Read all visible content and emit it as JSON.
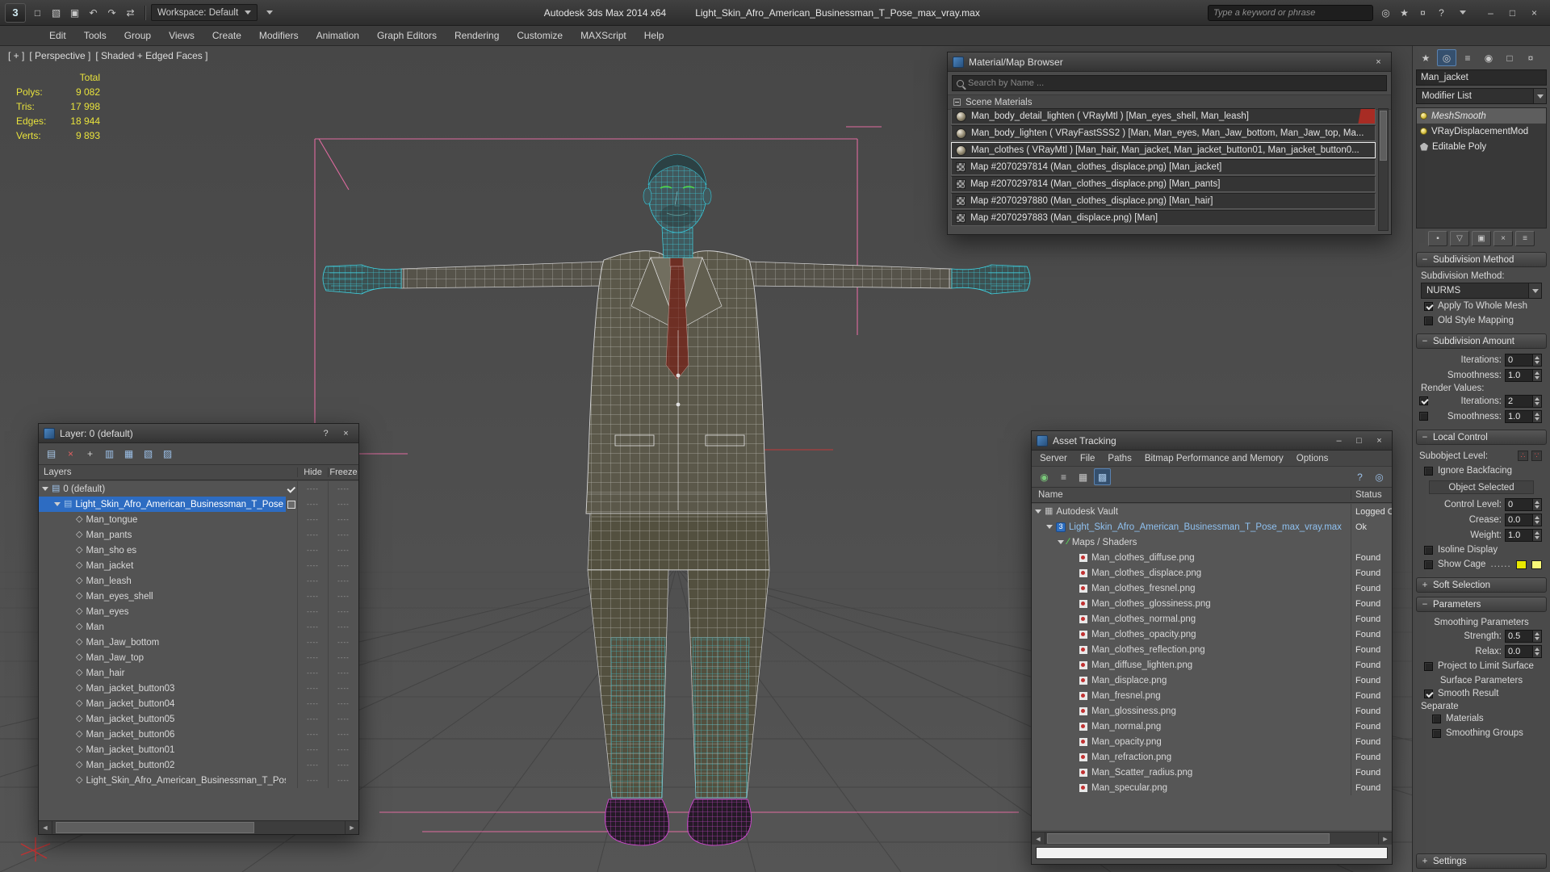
{
  "icons": {
    "app_logo": "3",
    "minus": "−",
    "plus": "+",
    "close": "×",
    "maximize": "□",
    "minimize": "–",
    "help": "?",
    "layer_glyph": "▤",
    "object_glyph": "◇",
    "vault_glyph": "▦",
    "maps_glyph": "∕",
    "maxfile_glyph": "3",
    "scroll_left": "◄",
    "scroll_right": "►"
  },
  "colors": {
    "accent_blue": "#2d6cc2",
    "stats_yellow": "#e8e23c",
    "cage_yellow_1": "#e8e800",
    "cage_yellow_2": "#f8f878"
  },
  "titlebar": {
    "app_title": "Autodesk 3ds Max  2014 x64",
    "doc_title": "Light_Skin_Afro_American_Businessman_T_Pose_max_vray.max",
    "workspace_label": "Workspace: Default",
    "search_placeholder": "Type a keyword or phrase",
    "qat_icons": [
      {
        "name": "new-scene-icon",
        "glyph": "□"
      },
      {
        "name": "open-file-icon",
        "glyph": "▧"
      },
      {
        "name": "save-file-icon",
        "glyph": "▣"
      },
      {
        "name": "undo-icon",
        "glyph": "↶"
      },
      {
        "name": "redo-icon",
        "glyph": "↷"
      },
      {
        "name": "select-and-link-icon",
        "glyph": "⇄"
      }
    ],
    "right_icons": [
      {
        "name": "search-go-icon",
        "glyph": "◎"
      },
      {
        "name": "favorites-icon",
        "glyph": "★"
      },
      {
        "name": "community-icon",
        "glyph": "¤"
      },
      {
        "name": "help-icon",
        "glyph": "?"
      }
    ]
  },
  "menubar": {
    "items": [
      "Edit",
      "Tools",
      "Group",
      "Views",
      "Create",
      "Modifiers",
      "Animation",
      "Graph Editors",
      "Rendering",
      "Customize",
      "MAXScript",
      "Help"
    ]
  },
  "viewport": {
    "menu_general": "[ + ]",
    "menu_pov": "[ Perspective ]",
    "menu_shading": "[ Shaded + Edged Faces ]",
    "stats_total_label": "Total",
    "stats": [
      {
        "label": "Polys:",
        "value": "9 082"
      },
      {
        "label": "Tris:",
        "value": "17 998"
      },
      {
        "label": "Edges:",
        "value": "18 944"
      },
      {
        "label": "Verts:",
        "value": "9 893"
      }
    ]
  },
  "material_browser": {
    "title": "Material/Map Browser",
    "search_placeholder": "Search by Name ...",
    "section_label": "Scene Materials",
    "rows": [
      {
        "kind": "mtl",
        "text": "Man_body_detail_lighten ( VRayMtl ) [Man_eyes_shell, Man_leash]",
        "red_chip": true
      },
      {
        "kind": "mtl",
        "text": "Man_body_lighten ( VRayFastSSS2 ) [Man, Man_eyes, Man_Jaw_bottom, Man_Jaw_top, Ma..."
      },
      {
        "kind": "mtl",
        "text": "Man_clothes ( VRayMtl ) [Man_hair, Man_jacket, Man_jacket_button01, Man_jacket_button0...",
        "selected": true
      },
      {
        "kind": "map",
        "text": "Map #2070297814 (Man_clothes_displace.png) [Man_jacket]"
      },
      {
        "kind": "map",
        "text": "Map #2070297814 (Man_clothes_displace.png) [Man_pants]"
      },
      {
        "kind": "map",
        "text": "Map #2070297880 (Man_clothes_displace.png) [Man_hair]"
      },
      {
        "kind": "map",
        "text": "Map #2070297883 (Man_displace.png) [Man]"
      }
    ]
  },
  "layer_explorer": {
    "title": "Layer: 0 (default)",
    "col_layers": "Layers",
    "col_hide": "Hide",
    "col_freeze": "Freeze",
    "dash_glyph": "----",
    "toolbar": [
      {
        "name": "create-new-layer-icon",
        "glyph": "▤",
        "color": "#a8c8e8"
      },
      {
        "name": "delete-layer-icon",
        "glyph": "×",
        "color": "#e06060"
      },
      {
        "name": "add-selection-to-layer-icon",
        "glyph": "+",
        "color": "#d0d0d0"
      },
      {
        "name": "select-objects-in-layer-icon",
        "glyph": "▥",
        "color": "#9cc0e8"
      },
      {
        "name": "set-current-layer-icon",
        "glyph": "▦",
        "color": "#9cc0e8"
      },
      {
        "name": "highlight-selected-layer-icon",
        "glyph": "▧",
        "color": "#9cc0e8"
      },
      {
        "name": "hide-freeze-options-icon",
        "glyph": "▨",
        "color": "#9cc0e8"
      }
    ],
    "rows": [
      {
        "name": "0 (default)",
        "kind": "layer",
        "level": 0,
        "expander": true,
        "current": true
      },
      {
        "name": "Light_Skin_Afro_American_Businessman_T_Pose",
        "kind": "layer",
        "level": 1,
        "expander": true,
        "selected": true,
        "box": true
      },
      {
        "name": "Man_tongue",
        "kind": "object",
        "level": 2
      },
      {
        "name": "Man_pants",
        "kind": "object",
        "level": 2
      },
      {
        "name": "Man_sho es",
        "kind": "object",
        "level": 2
      },
      {
        "name": "Man_jacket",
        "kind": "object",
        "level": 2
      },
      {
        "name": "Man_leash",
        "kind": "object",
        "level": 2
      },
      {
        "name": "Man_eyes_shell",
        "kind": "object",
        "level": 2
      },
      {
        "name": "Man_eyes",
        "kind": "object",
        "level": 2
      },
      {
        "name": "Man",
        "kind": "object",
        "level": 2
      },
      {
        "name": "Man_Jaw_bottom",
        "kind": "object",
        "level": 2
      },
      {
        "name": "Man_Jaw_top",
        "kind": "object",
        "level": 2
      },
      {
        "name": "Man_hair",
        "kind": "object",
        "level": 2
      },
      {
        "name": "Man_jacket_button03",
        "kind": "object",
        "level": 2
      },
      {
        "name": "Man_jacket_button04",
        "kind": "object",
        "level": 2
      },
      {
        "name": "Man_jacket_button05",
        "kind": "object",
        "level": 2
      },
      {
        "name": "Man_jacket_button06",
        "kind": "object",
        "level": 2
      },
      {
        "name": "Man_jacket_button01",
        "kind": "object",
        "level": 2
      },
      {
        "name": "Man_jacket_button02",
        "kind": "object",
        "level": 2
      },
      {
        "name": "Light_Skin_Afro_American_Businessman_T_Pose",
        "kind": "object",
        "level": 2
      }
    ]
  },
  "asset_tracking": {
    "title": "Asset Tracking",
    "menu": [
      "Server",
      "File",
      "Paths",
      "Bitmap Performance and Memory",
      "Options"
    ],
    "col_name": "Name",
    "col_status": "Status",
    "toolbar_left": [
      {
        "name": "refresh-status-icon",
        "glyph": "◉",
        "color": "#7ac87a"
      },
      {
        "name": "report-view-icon",
        "glyph": "≡",
        "color": "#c8c8c8"
      },
      {
        "name": "table-view-icon",
        "glyph": "▦",
        "color": "#c8c8c8"
      },
      {
        "name": "thumbnail-view-icon",
        "glyph": "▩",
        "color": "#a8c8e8",
        "active": true
      }
    ],
    "toolbar_right": [
      {
        "name": "vault-help-icon",
        "glyph": "?",
        "color": "#9cc0e8"
      },
      {
        "name": "vault-options-icon",
        "glyph": "◎",
        "color": "#9cc0e8"
      }
    ],
    "rows": [
      {
        "name": "Autodesk Vault",
        "status": "Logged Out",
        "level": 0,
        "icon": "vault",
        "expander": true
      },
      {
        "name": "Light_Skin_Afro_American_Businessman_T_Pose_max_vray.max",
        "status": "Ok",
        "level": 1,
        "icon": "maxfile",
        "expander": true,
        "blue": true
      },
      {
        "name": "Maps / Shaders",
        "status": "",
        "level": 2,
        "icon": "maps",
        "expander": true
      },
      {
        "name": "Man_clothes_diffuse.png",
        "status": "Found",
        "level": 3,
        "icon": "png"
      },
      {
        "name": "Man_clothes_displace.png",
        "status": "Found",
        "level": 3,
        "icon": "png"
      },
      {
        "name": "Man_clothes_fresnel.png",
        "status": "Found",
        "level": 3,
        "icon": "png"
      },
      {
        "name": "Man_clothes_glossiness.png",
        "status": "Found",
        "level": 3,
        "icon": "png"
      },
      {
        "name": "Man_clothes_normal.png",
        "status": "Found",
        "level": 3,
        "icon": "png"
      },
      {
        "name": "Man_clothes_opacity.png",
        "status": "Found",
        "level": 3,
        "icon": "png"
      },
      {
        "name": "Man_clothes_reflection.png",
        "status": "Found",
        "level": 3,
        "icon": "png"
      },
      {
        "name": "Man_diffuse_lighten.png",
        "status": "Found",
        "level": 3,
        "icon": "png"
      },
      {
        "name": "Man_displace.png",
        "status": "Found",
        "level": 3,
        "icon": "png"
      },
      {
        "name": "Man_fresnel.png",
        "status": "Found",
        "level": 3,
        "icon": "png"
      },
      {
        "name": "Man_glossiness.png",
        "status": "Found",
        "level": 3,
        "icon": "png"
      },
      {
        "name": "Man_normal.png",
        "status": "Found",
        "level": 3,
        "icon": "png"
      },
      {
        "name": "Man_opacity.png",
        "status": "Found",
        "level": 3,
        "icon": "png"
      },
      {
        "name": "Man_refraction.png",
        "status": "Found",
        "level": 3,
        "icon": "png"
      },
      {
        "name": "Man_Scatter_radius.png",
        "status": "Found",
        "level": 3,
        "icon": "png"
      },
      {
        "name": "Man_specular.png",
        "status": "Found",
        "level": 3,
        "icon": "png"
      }
    ]
  },
  "command_panel": {
    "tabs": [
      {
        "name": "create-tab-icon",
        "glyph": "★"
      },
      {
        "name": "modify-tab-icon",
        "glyph": "◎",
        "active": true
      },
      {
        "name": "hierarchy-tab-icon",
        "glyph": "≡"
      },
      {
        "name": "motion-tab-icon",
        "glyph": "◉"
      },
      {
        "name": "display-tab-icon",
        "glyph": "□"
      },
      {
        "name": "utilities-tab-icon",
        "glyph": "¤"
      }
    ],
    "object_name": "Man_jacket",
    "modifier_list_label": "Modifier List",
    "stack": [
      {
        "name": "MeshSmooth",
        "bulb": true,
        "selected": true,
        "italic": true
      },
      {
        "name": "VRayDisplacementMod",
        "bulb": true
      },
      {
        "name": "Editable Poly",
        "bulb": false
      }
    ],
    "stack_buttons": [
      {
        "name": "pin-stack-button",
        "glyph": "▪"
      },
      {
        "name": "show-end-result-button",
        "glyph": "▽"
      },
      {
        "name": "make-unique-button",
        "glyph": "▣"
      },
      {
        "name": "remove-modifier-button",
        "glyph": "×"
      },
      {
        "name": "configure-modifier-sets-button",
        "glyph": "≡"
      }
    ],
    "rollouts": {
      "subdivision_method": {
        "title": "Subdivision Method",
        "pm": "−"
      },
      "subdivision_amount": {
        "title": "Subdivision Amount",
        "pm": "−"
      },
      "local_control": {
        "title": "Local Control",
        "pm": "−"
      },
      "soft_selection": {
        "title": "Soft Selection",
        "pm": "+"
      },
      "parameters": {
        "title": "Parameters",
        "pm": "−"
      },
      "settings": {
        "title": "Settings",
        "pm": "+"
      }
    },
    "labels": {
      "subdivision_method_label": "Subdivision Method:",
      "apply_whole": "Apply To Whole Mesh",
      "old_style": "Old Style Mapping",
      "iterations": "Iterations:",
      "smoothness": "Smoothness:",
      "render_values": "Render Values:",
      "subobject_level": "Subobject Level:",
      "ignore_backfacing": "Ignore Backfacing",
      "object_selected": "Object Selected",
      "control_level": "Control Level:",
      "crease": "Crease:",
      "weight": "Weight:",
      "isoline": "Isoline Display",
      "show_cage": "Show Cage",
      "show_cage_dots": "......",
      "smoothing_parameters": "Smoothing Parameters",
      "strength": "Strength:",
      "relax": "Relax:",
      "project_limit": "Project to Limit Surface",
      "surface_parameters": "Surface Parameters",
      "smooth_result": "Smooth Result",
      "separate": "Separate",
      "materials": "Materials",
      "smoothing_groups": "Smoothing Groups"
    },
    "values": {
      "subdivision_method": "NURMS",
      "iterations": "0",
      "smoothness": "1.0",
      "render_iterations": "2",
      "render_smoothness": "1.0",
      "control_level": "0",
      "crease": "0.0",
      "weight": "1.0",
      "strength": "0.5",
      "relax": "0.0"
    },
    "checks": {
      "apply_whole": true,
      "old_style": false,
      "render_iterations": true,
      "render_smoothness": false,
      "ignore_backfacing": false,
      "isoline": false,
      "show_cage": false,
      "project_limit": false,
      "smooth_result": true,
      "materials": false,
      "smoothing_groups": false
    }
  }
}
